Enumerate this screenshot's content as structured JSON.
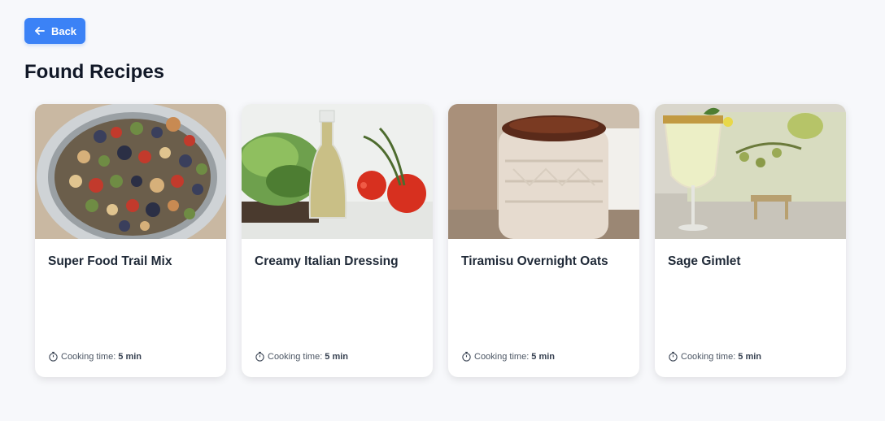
{
  "header": {
    "back_label": "Back",
    "title": "Found Recipes"
  },
  "recipes": [
    {
      "name": "Super Food Trail Mix",
      "time_label": "Cooking time:",
      "time_value": "5 min"
    },
    {
      "name": "Creamy Italian Dressing",
      "time_label": "Cooking time:",
      "time_value": "5 min"
    },
    {
      "name": "Tiramisu Overnight Oats",
      "time_label": "Cooking time:",
      "time_value": "5 min"
    },
    {
      "name": "Sage Gimlet",
      "time_label": "Cooking time:",
      "time_value": "5 min"
    }
  ],
  "icons": {
    "back": "arrow-left-icon",
    "timer": "stopwatch-icon"
  },
  "colors": {
    "accent": "#3b82f6",
    "background": "#f7f8fb"
  }
}
